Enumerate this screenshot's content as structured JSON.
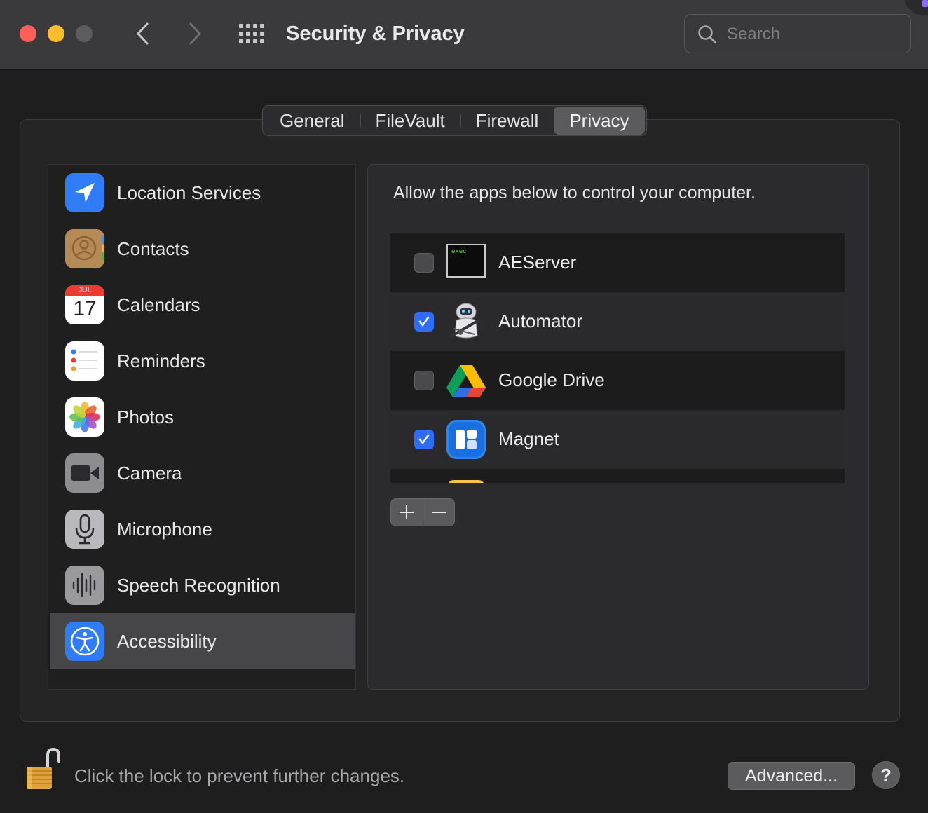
{
  "window": {
    "title": "Security & Privacy",
    "search_placeholder": "Search"
  },
  "tabs": [
    {
      "label": "General",
      "active": false
    },
    {
      "label": "FileVault",
      "active": false
    },
    {
      "label": "Firewall",
      "active": false
    },
    {
      "label": "Privacy",
      "active": true
    }
  ],
  "sidebar": {
    "items": [
      {
        "label": "Location Services",
        "icon": "location-arrow-icon"
      },
      {
        "label": "Contacts",
        "icon": "contacts-icon"
      },
      {
        "label": "Calendars",
        "icon": "calendar-icon",
        "month": "JUL",
        "day": "17"
      },
      {
        "label": "Reminders",
        "icon": "reminders-icon"
      },
      {
        "label": "Photos",
        "icon": "photos-icon"
      },
      {
        "label": "Camera",
        "icon": "camera-icon"
      },
      {
        "label": "Microphone",
        "icon": "microphone-icon"
      },
      {
        "label": "Speech Recognition",
        "icon": "speech-recognition-icon"
      },
      {
        "label": "Accessibility",
        "icon": "accessibility-icon",
        "selected": true
      }
    ]
  },
  "panel": {
    "description": "Allow the apps below to control your computer.",
    "apps": [
      {
        "name": "AEServer",
        "checked": false,
        "icon": "terminal-exec-icon",
        "icon_text": "exec"
      },
      {
        "name": "Automator",
        "checked": true,
        "icon": "automator-robot-icon"
      },
      {
        "name": "Google Drive",
        "checked": false,
        "icon": "google-drive-icon"
      },
      {
        "name": "Magnet",
        "checked": true,
        "icon": "magnet-icon"
      }
    ],
    "add_symbol": "+",
    "remove_symbol": "−"
  },
  "footer": {
    "lock_text": "Click the lock to prevent further changes.",
    "advanced_label": "Advanced...",
    "help_label": "?"
  },
  "colors": {
    "accent_blue": "#2f6df6",
    "close": "#ff5f57",
    "minimize": "#febc2e"
  }
}
